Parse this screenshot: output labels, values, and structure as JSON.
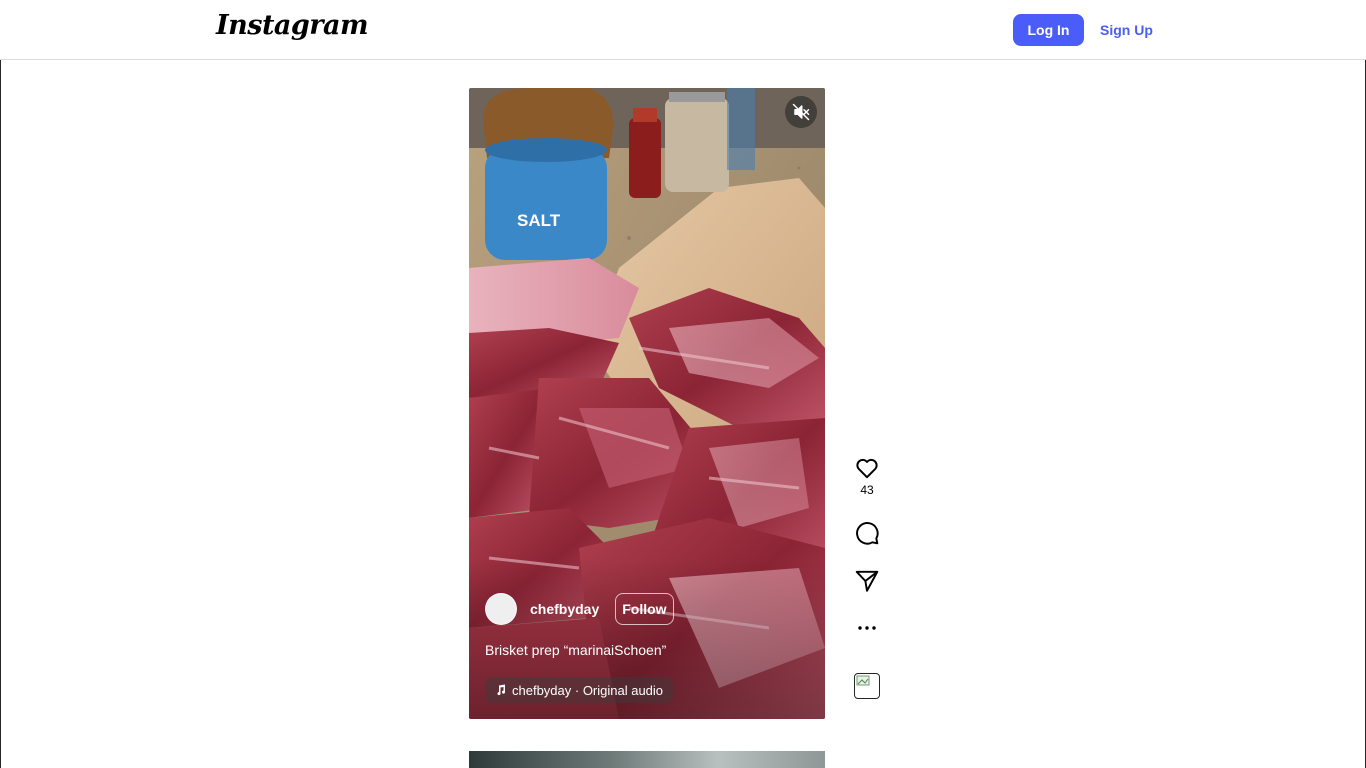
{
  "header": {
    "logo_text": "Instagram",
    "login_label": "Log In",
    "signup_label": "Sign Up"
  },
  "reel": {
    "author": "chefbyday",
    "follow_label": "Follow",
    "caption": "Brisket prep “marinaiSchoen”",
    "audio": "chefbyday · Original audio",
    "salt_label": "SALT",
    "likes": "43",
    "mute_icon": "speaker-muted-icon"
  },
  "actions": {
    "like_icon": "heart-icon",
    "comment_icon": "comment-icon",
    "share_icon": "send-icon",
    "more_icon": "more-icon"
  },
  "colors": {
    "accent": "#4a5df9",
    "border": "#dbdbdb"
  }
}
